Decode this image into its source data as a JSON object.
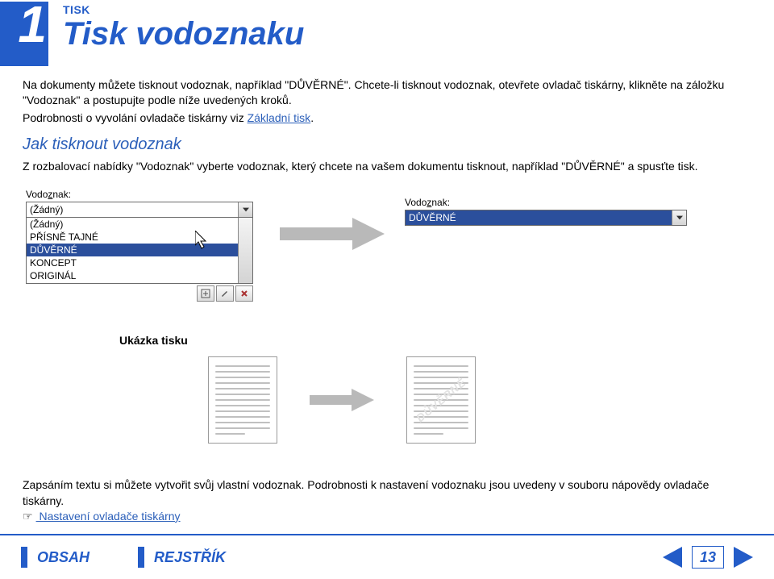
{
  "header": {
    "chapter_number": "1",
    "section_label": "TISK",
    "page_title": "Tisk vodoznaku"
  },
  "intro": {
    "p1": "Na dokumenty můžete tisknout vodoznak, například \"DŮVĚRNÉ\". Chcete-li tisknout vodoznak, otevřete ovladač tiskárny, klikněte na záložku \"Vodoznak\" a postupujte podle níže uvedených kroků.",
    "p2_prefix": "Podrobnosti o vyvolání ovladače tiskárny viz ",
    "p2_link": "Základní tisk",
    "p2_suffix": "."
  },
  "step": {
    "title": "Jak tisknout vodoznak",
    "desc": "Z rozbalovací nabídky \"Vodoznak\" vyberte vodoznak, který chcete na vašem dokumentu tisknout, například \"DŮVĚRNÉ\" a spusťte tisk."
  },
  "dialog_left": {
    "label_prefix": "Vodo",
    "label_underlined": "z",
    "label_suffix": "nak:",
    "combo_value": "(Žádný)",
    "options": [
      "(Žádný)",
      "PŘÍSNĚ TAJNÉ",
      "DŮVĚRNÉ",
      "KONCEPT",
      "ORIGINÁL"
    ],
    "selected_index": 2
  },
  "dialog_right": {
    "label_prefix": "Vodo",
    "label_underlined": "z",
    "label_suffix": "nak:",
    "selected_value": "DŮVĚRNÉ"
  },
  "sample": {
    "title": "Ukázka tisku",
    "watermark_text": "DŮVĚRNÉ"
  },
  "lower": {
    "p1": "Zapsáním textu si můžete vytvořit svůj vlastní vodoznak. Podrobnosti k nastavení vodoznaku jsou uvedeny v souboru nápovědy ovladače tiskárny.",
    "pointer": "☞",
    "link": " Nastavení ovladače tiskárny"
  },
  "footer": {
    "btn1": "OBSAH",
    "btn2": "REJSTŘÍK",
    "page_number": "13"
  }
}
